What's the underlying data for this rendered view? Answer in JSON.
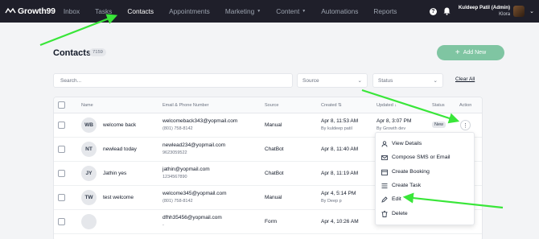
{
  "app": {
    "logo_text": "Growth99"
  },
  "nav": {
    "items": [
      {
        "label": "Inbox",
        "active": false,
        "dropdown": false
      },
      {
        "label": "Tasks",
        "active": false,
        "dropdown": false
      },
      {
        "label": "Contacts",
        "active": true,
        "dropdown": false
      },
      {
        "label": "Appointments",
        "active": false,
        "dropdown": false
      },
      {
        "label": "Marketing",
        "active": false,
        "dropdown": true
      },
      {
        "label": "Content",
        "active": false,
        "dropdown": true
      },
      {
        "label": "Automations",
        "active": false,
        "dropdown": false
      },
      {
        "label": "Reports",
        "active": false,
        "dropdown": false
      }
    ]
  },
  "user": {
    "name": "Kuldeep Patil (Admin)",
    "org": "Klora"
  },
  "page": {
    "title": "Contacts",
    "count": "7159",
    "add_new_label": "Add New",
    "search_placeholder": "Search...",
    "source_filter": "Source",
    "status_filter": "Status",
    "clear_all": "Clear All"
  },
  "table": {
    "headers": {
      "name": "Name",
      "email_phone": "Email & Phone Number",
      "source": "Source",
      "created": "Created",
      "updated": "Updated",
      "status": "Status",
      "action": "Action"
    },
    "rows": [
      {
        "initials": "WB",
        "name": "welcome back",
        "email": "welcomeback343@yopmail.com",
        "phone": "(801) 758-8142",
        "source": "Manual",
        "created": "Apr 8, 11:53 AM",
        "created_by": "By kuldeep patil",
        "updated": "Apr 8, 3:07 PM",
        "updated_by": "By Growth dev",
        "status": "New"
      },
      {
        "initials": "NT",
        "name": "newlead today",
        "email": "newlead234@yopmail.com",
        "phone": "9623059522",
        "source": "ChatBot",
        "created": "Apr 8, 11:40 AM",
        "created_by": "",
        "updated": "",
        "updated_by": "",
        "status": ""
      },
      {
        "initials": "JY",
        "name": "Jathin yes",
        "email": "jathin@yopmail.com",
        "phone": "1234567890",
        "source": "ChatBot",
        "created": "Apr 8, 11:19 AM",
        "created_by": "",
        "updated": "",
        "updated_by": "",
        "status": ""
      },
      {
        "initials": "TW",
        "name": "test welcome",
        "email": "welcome345@yopmail.com",
        "phone": "(801) 758-8142",
        "source": "Manual",
        "created": "Apr 4, 5:14 PM",
        "created_by": "By Deep p",
        "updated": "",
        "updated_by": "",
        "status": ""
      },
      {
        "initials": "",
        "name": "",
        "email": "dfhh35456@yopmail.com",
        "phone": "-",
        "source": "Form",
        "created": "Apr 4, 10:26 AM",
        "created_by": "",
        "updated": "",
        "updated_by": "",
        "status": ""
      }
    ]
  },
  "menu": {
    "items": [
      {
        "label": "View Details",
        "icon": "user-icon"
      },
      {
        "label": "Compose SMS or Email",
        "icon": "mail-icon"
      },
      {
        "label": "Create Booking",
        "icon": "calendar-icon"
      },
      {
        "label": "Create Task",
        "icon": "list-icon"
      },
      {
        "label": "Edit",
        "icon": "pencil-icon"
      },
      {
        "label": "Delete",
        "icon": "trash-icon"
      }
    ]
  },
  "colors": {
    "nav_bg": "#1f1f2a",
    "accent_green": "#7fc5a2",
    "arrow_green": "#39e639"
  }
}
